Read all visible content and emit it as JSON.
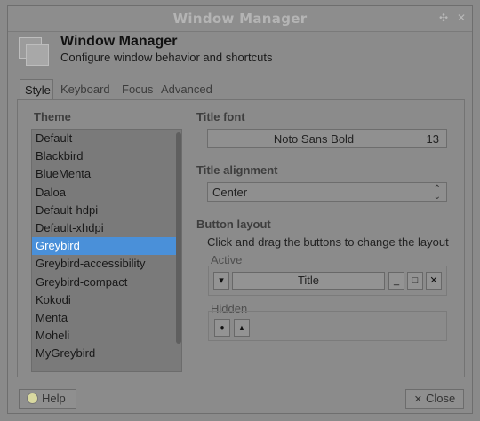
{
  "window": {
    "title": "Window Manager",
    "controls": {
      "restore_glyph": "✣",
      "close_glyph": "✕"
    }
  },
  "header": {
    "title": "Window Manager",
    "subtitle": "Configure window behavior and shortcuts",
    "icon": "window-manager-icon"
  },
  "tabs": [
    {
      "label": "Style",
      "active": true
    },
    {
      "label": "Keyboard",
      "active": false
    },
    {
      "label": "Focus",
      "active": false
    },
    {
      "label": "Advanced",
      "active": false
    }
  ],
  "theme": {
    "heading": "Theme",
    "items": [
      "Default",
      "Blackbird",
      "BlueMenta",
      "Daloa",
      "Default-hdpi",
      "Default-xhdpi",
      "Greybird",
      "Greybird-accessibility",
      "Greybird-compact",
      "Kokodi",
      "Menta",
      "Moheli",
      "MyGreybird"
    ],
    "selected": "Greybird"
  },
  "title_font": {
    "heading": "Title font",
    "family": "Noto Sans Bold",
    "size": "13"
  },
  "title_alignment": {
    "heading": "Title alignment",
    "value": "Center"
  },
  "button_layout": {
    "heading": "Button layout",
    "hint": "Click and drag the buttons to change the layout",
    "active_label": "Active",
    "hidden_label": "Hidden",
    "active_buttons": {
      "menu_glyph": "▾",
      "title_label": "Title",
      "minimize_glyph": "_",
      "maximize_glyph": "□",
      "close_glyph": "✕"
    },
    "hidden_buttons": {
      "stick_glyph": "●",
      "shade_glyph": "▲"
    }
  },
  "footer": {
    "help_label": "Help",
    "close_label": "Close",
    "close_glyph": "✕"
  },
  "colors": {
    "selection": "#4a90d9",
    "overlay": "#8a8a8a"
  }
}
